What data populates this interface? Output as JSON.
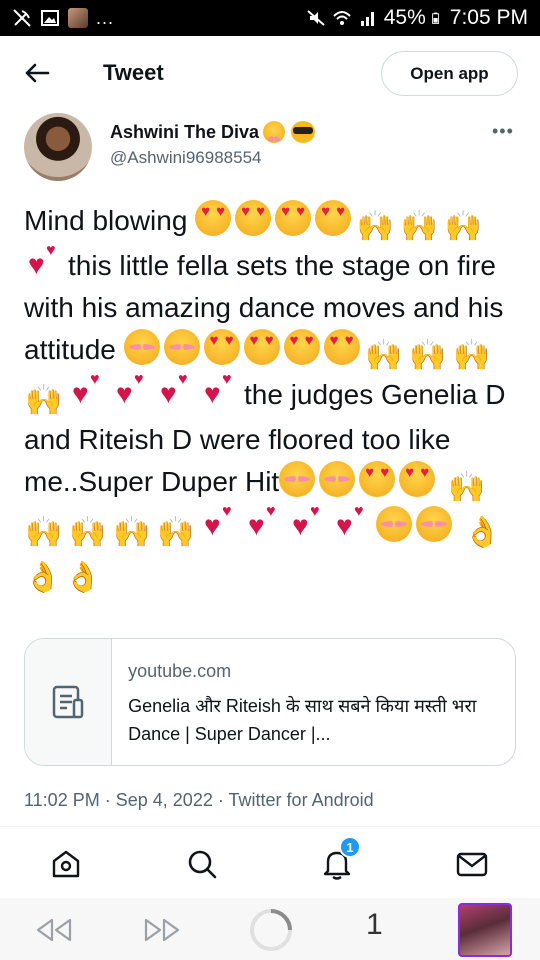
{
  "status_bar": {
    "battery": "45%",
    "time": "7:05 PM",
    "overflow": "..."
  },
  "header": {
    "title": "Tweet",
    "open_app_label": "Open app"
  },
  "author": {
    "name": "Ashwini The Diva",
    "name_emojis": [
      "wink-face-emoji",
      "sunglasses-face-emoji"
    ],
    "handle": "@Ashwini96988554"
  },
  "tweet": {
    "segments": [
      "Mind blowing",
      "this little fella sets the stage on fire with his amazing dance moves and his attitude",
      "the judges Genelia D and Riteish D were floored too like me..Super Duper Hit"
    ]
  },
  "link_card": {
    "domain": "youtube.com",
    "title": "Genelia और Riteish के साथ सबने किया मस्ती भरा Dance | Super Dancer |..."
  },
  "meta": {
    "time": "11:02 PM",
    "date": "Sep 4, 2022",
    "source": "Twitter for Android",
    "separator": "·"
  },
  "bottom_nav": {
    "notification_count": "1"
  },
  "browser": {
    "tab_count": "1"
  },
  "colors": {
    "accent": "#1d9bf0",
    "text": "#0f1419",
    "secondary": "#536471",
    "border": "#cfd9de"
  }
}
